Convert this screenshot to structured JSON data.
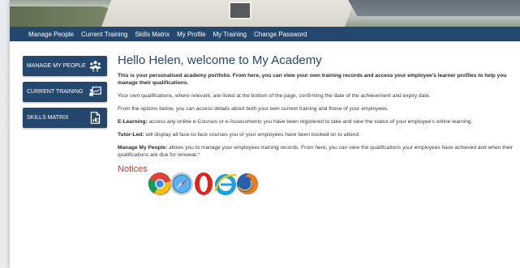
{
  "nav": {
    "items": [
      "Manage People",
      "Current Training",
      "Skills Matrix",
      "My Profile",
      "My Training",
      "Change Password"
    ]
  },
  "sidebar": {
    "buttons": [
      {
        "label": "MANAGE MY PEOPLE",
        "icon": "people-icon"
      },
      {
        "label": "CURRENT TRAINING",
        "icon": "training-board-icon"
      },
      {
        "label": "SKILLS MATRIX",
        "icon": "document-chart-icon"
      }
    ]
  },
  "main": {
    "title": "Hello Helen, welcome to My Academy",
    "intro": "This is your personalised academy portfolio. From here, you can view your own training records and access your employee's learner profiles to help you manage their qualifications.",
    "para1": "Your own qualifications, where relevant, are listed at the bottom of the page, confirming the date of the achievement and expiry date.",
    "para2": "From the options below, you can access details about both your own current training and those of your employees.",
    "elearning_label": "E-Learning:",
    "elearning_text": " access any online e-Courses or e-Assessments you have been registered to take and view the status of your employee's online learning.",
    "tutor_label": "Tutor-Led:",
    "tutor_text": " will display all face-to-face courses you or your employees have been booked on to attend.",
    "manage_label": "Manage My People:",
    "manage_text": " allows you to manage your employees training records. From here, you can view the qualifications your employees have achieved and when their qualifications are due for renewal.*",
    "notices_title": "Notices"
  },
  "browsers": [
    "chrome-icon",
    "safari-icon",
    "opera-icon",
    "internet-explorer-icon",
    "firefox-icon"
  ],
  "colors": {
    "nav_bg": "#24476e",
    "title": "#24476e",
    "notices": "#c0392b"
  }
}
